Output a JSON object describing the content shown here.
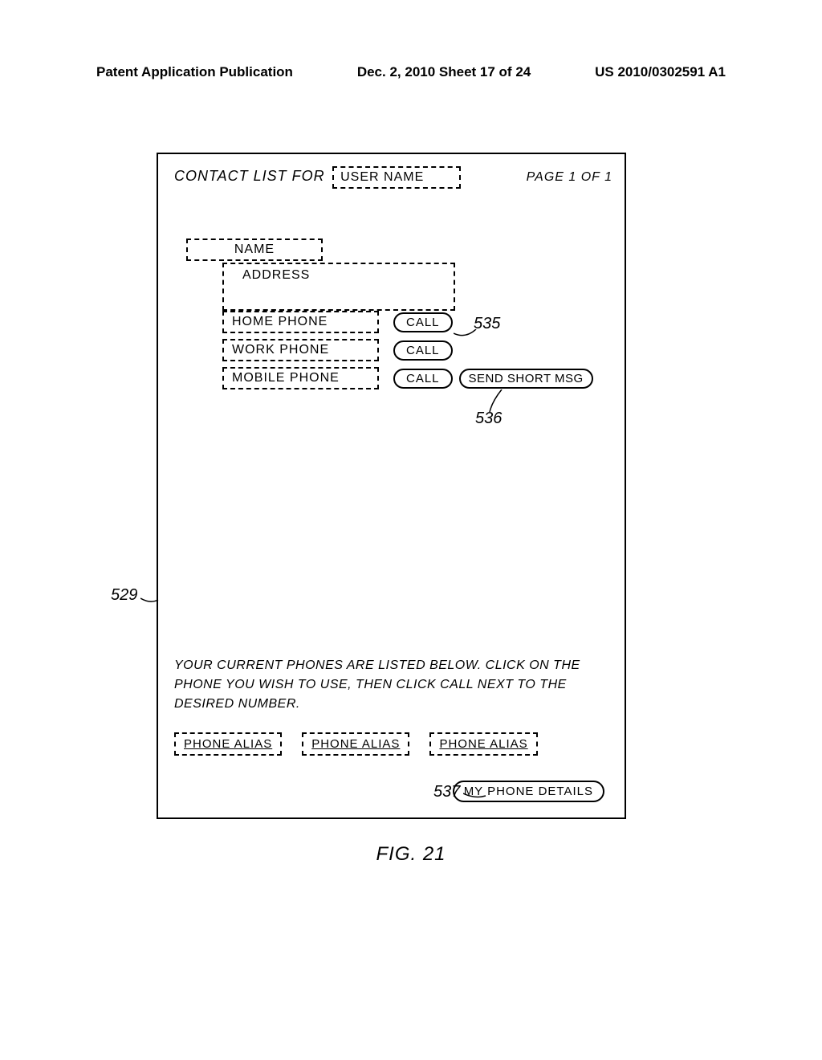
{
  "header": {
    "left": "Patent Application Publication",
    "mid": "Dec. 2, 2010   Sheet 17 of 24",
    "right": "US 2010/0302591 A1"
  },
  "figure": {
    "title_prefix": "CONTACT LIST FOR",
    "user_name": "USER NAME",
    "page_info": "PAGE 1 OF 1",
    "name_label": "NAME",
    "address_label": "ADDRESS",
    "phones": {
      "home": "HOME PHONE",
      "work": "WORK PHONE",
      "mobile": "MOBILE PHONE"
    },
    "call_label": "CALL",
    "sms_label": "SEND SHORT MSG",
    "instructions": "YOUR CURRENT PHONES ARE LISTED BELOW. CLICK ON THE PHONE YOU WISH TO USE, THEN CLICK CALL NEXT TO THE DESIRED NUMBER.",
    "aliases": [
      "PHONE ALIAS",
      "PHONE ALIAS",
      "PHONE ALIAS"
    ],
    "details_label": "MY PHONE DETAILS"
  },
  "refs": {
    "r535": "535",
    "r536": "536",
    "r529": "529",
    "r537": "537"
  },
  "fig_caption": "FIG. 21"
}
